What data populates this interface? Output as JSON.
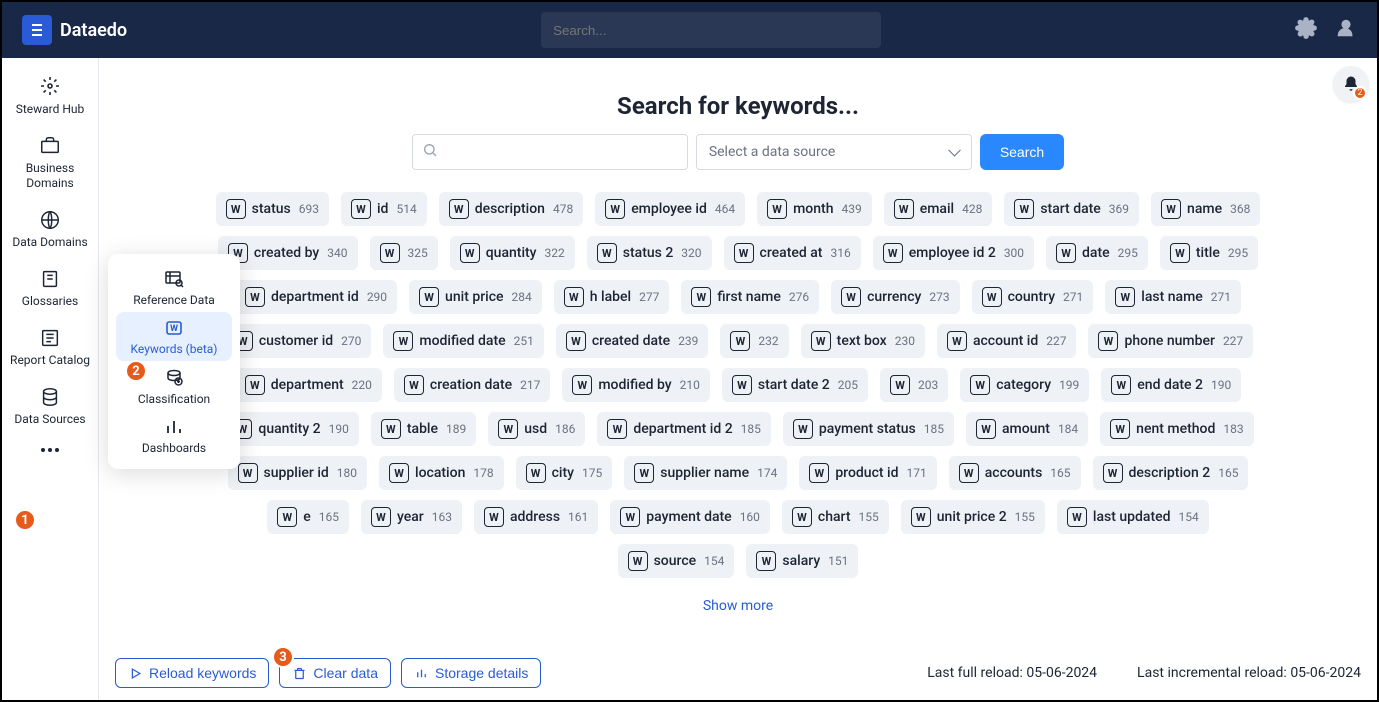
{
  "app_name": "Dataedo",
  "header": {
    "search_placeholder": "Search..."
  },
  "sidebar": {
    "items": [
      {
        "label": "Steward Hub",
        "icon": "cog-star"
      },
      {
        "label": "Business Domains",
        "icon": "briefcase"
      },
      {
        "label": "Data Domains",
        "icon": "globe"
      },
      {
        "label": "Glossaries",
        "icon": "book"
      },
      {
        "label": "Report Catalog",
        "icon": "report"
      },
      {
        "label": "Data Sources",
        "icon": "db"
      }
    ]
  },
  "flyout": {
    "items": [
      {
        "label": "Reference Data"
      },
      {
        "label": "Keywords (beta)"
      },
      {
        "label": "Classification"
      },
      {
        "label": "Dashboards"
      }
    ]
  },
  "main": {
    "title": "Search for keywords...",
    "select_placeholder": "Select a data source",
    "search_label": "Search",
    "show_more": "Show more"
  },
  "keywords": [
    {
      "label": "status",
      "count": 693
    },
    {
      "label": "id",
      "count": 514
    },
    {
      "label": "description",
      "count": 478
    },
    {
      "label": "employee id",
      "count": 464
    },
    {
      "label": "month",
      "count": 439
    },
    {
      "label": "email",
      "count": 428
    },
    {
      "label": "start date",
      "count": 369
    },
    {
      "label": "name",
      "count": 368
    },
    {
      "label": "created by",
      "count": 340
    },
    {
      "label": "",
      "count": 325
    },
    {
      "label": "quantity",
      "count": 322
    },
    {
      "label": "status 2",
      "count": 320
    },
    {
      "label": "created at",
      "count": 316
    },
    {
      "label": "employee id 2",
      "count": 300
    },
    {
      "label": "date",
      "count": 295
    },
    {
      "label": "title",
      "count": 295
    },
    {
      "label": "department id",
      "count": 290
    },
    {
      "label": "unit price",
      "count": 284
    },
    {
      "label": "h label",
      "count": 277
    },
    {
      "label": "first name",
      "count": 276
    },
    {
      "label": "currency",
      "count": 273
    },
    {
      "label": "country",
      "count": 271
    },
    {
      "label": "last name",
      "count": 271
    },
    {
      "label": "customer id",
      "count": 270
    },
    {
      "label": "modified date",
      "count": 251
    },
    {
      "label": "created date",
      "count": 239
    },
    {
      "label": "",
      "count": 232
    },
    {
      "label": "text box",
      "count": 230
    },
    {
      "label": "account id",
      "count": 227
    },
    {
      "label": "phone number",
      "count": 227
    },
    {
      "label": "department",
      "count": 220
    },
    {
      "label": "creation date",
      "count": 217
    },
    {
      "label": "modified by",
      "count": 210
    },
    {
      "label": "start date 2",
      "count": 205
    },
    {
      "label": "",
      "count": 203
    },
    {
      "label": "category",
      "count": 199
    },
    {
      "label": "end date 2",
      "count": 190
    },
    {
      "label": "quantity 2",
      "count": 190
    },
    {
      "label": "table",
      "count": 189
    },
    {
      "label": "usd",
      "count": 186
    },
    {
      "label": "department id 2",
      "count": 185
    },
    {
      "label": "payment status",
      "count": 185
    },
    {
      "label": "amount",
      "count": 184
    },
    {
      "label": "nent method",
      "count": 183
    },
    {
      "label": "supplier id",
      "count": 180
    },
    {
      "label": "location",
      "count": 178
    },
    {
      "label": "city",
      "count": 175
    },
    {
      "label": "supplier name",
      "count": 174
    },
    {
      "label": "product id",
      "count": 171
    },
    {
      "label": "accounts",
      "count": 165
    },
    {
      "label": "description 2",
      "count": 165
    },
    {
      "label": "e",
      "count": 165
    },
    {
      "label": "year",
      "count": 163
    },
    {
      "label": "address",
      "count": 161
    },
    {
      "label": "payment date",
      "count": 160
    },
    {
      "label": "chart",
      "count": 155
    },
    {
      "label": "unit price 2",
      "count": 155
    },
    {
      "label": "last updated",
      "count": 154
    },
    {
      "label": "source",
      "count": 154
    },
    {
      "label": "salary",
      "count": 151
    }
  ],
  "bottom": {
    "reload": "Reload keywords",
    "clear": "Clear data",
    "storage": "Storage details",
    "full_reload_label": "Last full reload:",
    "full_reload_date": "05-06-2024",
    "inc_reload_label": "Last incremental reload:",
    "inc_reload_date": "05-06-2024"
  },
  "annotations": {
    "a1": "1",
    "a2": "2",
    "a3": "3"
  },
  "notification_count": "2"
}
